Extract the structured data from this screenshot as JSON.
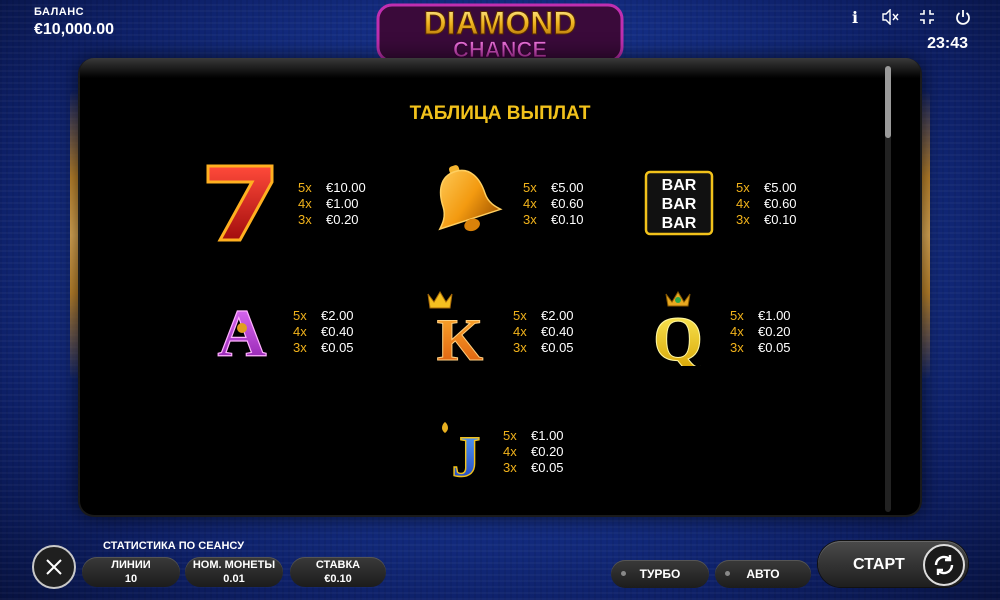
{
  "header": {
    "balance_label": "БАЛАНС",
    "balance_value": "€10,000.00",
    "logo_line1": "DIAMOND",
    "logo_line2": "CHANCE",
    "clock": "23:43",
    "icons": [
      "info-icon",
      "sound-off-icon",
      "fullscreen-exit-icon",
      "power-icon"
    ],
    "info_glyph": "i"
  },
  "paytable": {
    "title": "ТАБЛИЦА ВЫПЛАТ",
    "symbols": [
      {
        "name": "seven",
        "glyph": "7",
        "pays": [
          {
            "m": "5x",
            "v": "€10.00"
          },
          {
            "m": "4x",
            "v": "€1.00"
          },
          {
            "m": "3x",
            "v": "€0.20"
          }
        ]
      },
      {
        "name": "bell",
        "glyph": "",
        "pays": [
          {
            "m": "5x",
            "v": "€5.00"
          },
          {
            "m": "4x",
            "v": "€0.60"
          },
          {
            "m": "3x",
            "v": "€0.10"
          }
        ]
      },
      {
        "name": "bar",
        "glyph": "BAR",
        "pays": [
          {
            "m": "5x",
            "v": "€5.00"
          },
          {
            "m": "4x",
            "v": "€0.60"
          },
          {
            "m": "3x",
            "v": "€0.10"
          }
        ]
      },
      {
        "name": "ace",
        "glyph": "A",
        "pays": [
          {
            "m": "5x",
            "v": "€2.00"
          },
          {
            "m": "4x",
            "v": "€0.40"
          },
          {
            "m": "3x",
            "v": "€0.05"
          }
        ]
      },
      {
        "name": "king",
        "glyph": "K",
        "pays": [
          {
            "m": "5x",
            "v": "€2.00"
          },
          {
            "m": "4x",
            "v": "€0.40"
          },
          {
            "m": "3x",
            "v": "€0.05"
          }
        ]
      },
      {
        "name": "queen",
        "glyph": "Q",
        "pays": [
          {
            "m": "5x",
            "v": "€1.00"
          },
          {
            "m": "4x",
            "v": "€0.20"
          },
          {
            "m": "3x",
            "v": "€0.05"
          }
        ]
      },
      {
        "name": "jack",
        "glyph": "J",
        "pays": [
          {
            "m": "5x",
            "v": "€1.00"
          },
          {
            "m": "4x",
            "v": "€0.20"
          },
          {
            "m": "3x",
            "v": "€0.05"
          }
        ]
      }
    ]
  },
  "footer": {
    "stats_label": "СТАТИСТИКА ПО СЕАНСУ",
    "lines_label": "ЛИНИИ",
    "lines_value": "10",
    "coin_label": "НОМ. МОНЕТЫ",
    "coin_value": "0.01",
    "bet_label": "СТАВКА",
    "bet_value": "€0.10",
    "turbo_label": "ТУРБО",
    "auto_label": "АВТО",
    "start_label": "СТАРТ"
  },
  "colors": {
    "accent_gold": "#f2c21b",
    "multiplier": "#f2b31b",
    "panel": "#000000",
    "background": "#1a3a9e"
  }
}
